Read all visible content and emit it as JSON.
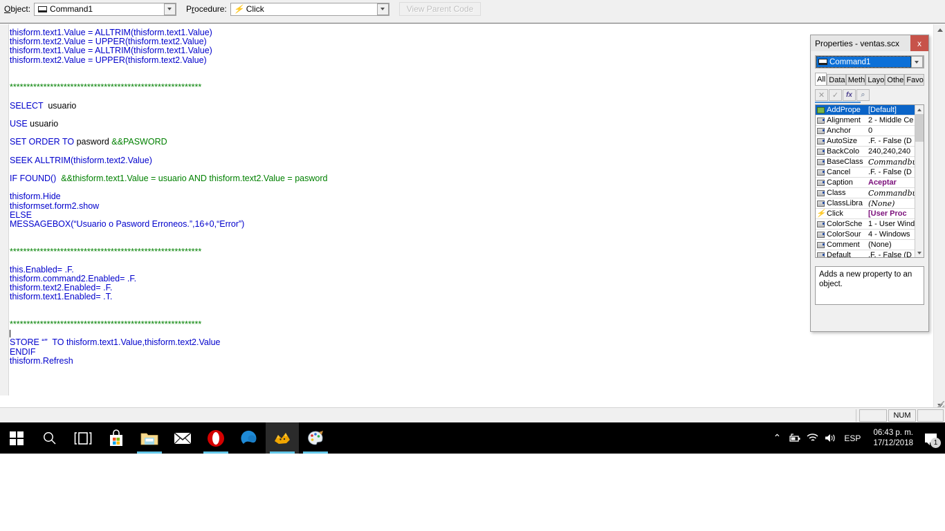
{
  "toolbar": {
    "object_label": "Object:",
    "object_value": "Command1",
    "procedure_label": "Procedure:",
    "procedure_value": "Click",
    "view_parent_code_label": "View Parent Code"
  },
  "editor": {
    "lines": [
      [
        {
          "t": "thisform.text1.Value = ALLTRIM(thisform.text1.Value)",
          "c": "kw"
        }
      ],
      [
        {
          "t": "thisform.text2.Value = UPPER(thisform.text2.Value)",
          "c": "kw"
        }
      ],
      [
        {
          "t": "thisform.text1.Value = ALLTRIM(thisform.text1.Value)",
          "c": "kw"
        }
      ],
      [
        {
          "t": "thisform.text2.Value = UPPER(thisform.text2.Value)",
          "c": "kw"
        }
      ],
      [],
      [],
      [
        {
          "t": "*********************************************************",
          "c": "cmt"
        }
      ],
      [],
      [
        {
          "t": "SELECT",
          "c": "kw"
        },
        {
          "t": "  usuario",
          "c": "plain"
        }
      ],
      [],
      [
        {
          "t": "USE",
          "c": "kw"
        },
        {
          "t": " usuario",
          "c": "plain"
        }
      ],
      [],
      [
        {
          "t": "SET ORDER TO",
          "c": "kw"
        },
        {
          "t": " pasword ",
          "c": "plain"
        },
        {
          "t": "&&PASWORD",
          "c": "cmt"
        }
      ],
      [],
      [
        {
          "t": "SEEK ALLTRIM(",
          "c": "kw"
        },
        {
          "t": "thisform.text2.Value)",
          "c": "kw"
        }
      ],
      [],
      [
        {
          "t": "IF FOUND()",
          "c": "kw"
        },
        {
          "t": "  &&thisform.text1.Value = usuario AND thisform.text2.Value = pasword",
          "c": "cmt"
        }
      ],
      [],
      [
        {
          "t": "thisform.Hide",
          "c": "kw"
        }
      ],
      [
        {
          "t": "thisformset.form2.show",
          "c": "kw"
        }
      ],
      [
        {
          "t": "ELSE",
          "c": "kw"
        }
      ],
      [
        {
          "t": "MESSAGEBOX(“Usuario o Pasword Erroneos.”,16+0,“Error”)",
          "c": "kw"
        }
      ],
      [],
      [],
      [
        {
          "t": "*********************************************************",
          "c": "cmt"
        }
      ],
      [],
      [
        {
          "t": "this.Enabled= .F.",
          "c": "kw"
        }
      ],
      [
        {
          "t": "thisform.command2.Enabled= .F.",
          "c": "kw"
        }
      ],
      [
        {
          "t": "thisform.text2.Enabled= .F.",
          "c": "kw"
        }
      ],
      [
        {
          "t": "thisform.text1.Enabled= .T.",
          "c": "kw"
        }
      ],
      [],
      [],
      [
        {
          "t": "*********************************************************",
          "c": "cmt"
        }
      ],
      [
        {
          "t": "",
          "c": "cursor"
        }
      ],
      [
        {
          "t": "STORE “”  TO thisform.text1.Value,thisform.text2.Value",
          "c": "kw"
        }
      ],
      [
        {
          "t": "ENDIF",
          "c": "kw"
        }
      ],
      [
        {
          "t": "thisform.Refresh",
          "c": "kw"
        }
      ]
    ]
  },
  "statusbar": {
    "panel1": "",
    "panel_num": "NUM",
    "panel3": ""
  },
  "properties": {
    "title": "Properties - ventas.scx",
    "close_label": "x",
    "object_value": "Command1",
    "tabs": [
      {
        "label": "All",
        "active": true
      },
      {
        "label": "Data",
        "active": false
      },
      {
        "label": "Meth",
        "active": false
      },
      {
        "label": "Layo",
        "active": false
      },
      {
        "label": "Othe",
        "active": false
      },
      {
        "label": "Favo",
        "active": false
      }
    ],
    "toolbar_buttons": [
      {
        "name": "cancel-edit-button",
        "glyph": "✕"
      },
      {
        "name": "accept-edit-button",
        "glyph": "✓"
      },
      {
        "name": "function-button",
        "glyph": "fx"
      },
      {
        "name": "zoom-button",
        "glyph": "⌕"
      }
    ],
    "rows": [
      {
        "icon": "add-property-icon",
        "name": "AddPrope",
        "value": "[Default]",
        "selected": true,
        "style": "normal"
      },
      {
        "icon": "property-icon",
        "name": "Alignment",
        "value": "2 - Middle Ce",
        "selected": false,
        "style": "normal"
      },
      {
        "icon": "property-icon",
        "name": "Anchor",
        "value": "0",
        "selected": false,
        "style": "normal"
      },
      {
        "icon": "property-icon",
        "name": "AutoSize",
        "value": ".F. - False (D",
        "selected": false,
        "style": "normal"
      },
      {
        "icon": "property-icon",
        "name": "BackColo",
        "value": "240,240,240",
        "selected": false,
        "style": "normal"
      },
      {
        "icon": "property-icon",
        "name": "BaseClass",
        "value": "Commandbu",
        "selected": false,
        "style": "script"
      },
      {
        "icon": "property-icon",
        "name": "Cancel",
        "value": ".F. - False (D",
        "selected": false,
        "style": "normal"
      },
      {
        "icon": "property-icon",
        "name": "Caption",
        "value": "Aceptar",
        "selected": false,
        "style": "purple"
      },
      {
        "icon": "property-icon",
        "name": "Class",
        "value": "Commandbu",
        "selected": false,
        "style": "script"
      },
      {
        "icon": "property-icon",
        "name": "ClassLibra",
        "value": "(None)",
        "selected": false,
        "style": "script"
      },
      {
        "icon": "event-icon",
        "name": "Click",
        "value": "[User Proc",
        "selected": false,
        "style": "purple"
      },
      {
        "icon": "property-icon",
        "name": "ColorSche",
        "value": "1 - User Wind",
        "selected": false,
        "style": "normal"
      },
      {
        "icon": "property-icon",
        "name": "ColorSour",
        "value": "4 - Windows",
        "selected": false,
        "style": "normal"
      },
      {
        "icon": "property-icon",
        "name": "Comment",
        "value": "(None)",
        "selected": false,
        "style": "normal"
      },
      {
        "icon": "property-icon",
        "name": "Default",
        "value": ".F. - False (D",
        "selected": false,
        "style": "normal"
      }
    ],
    "description": "Adds a new property to an object."
  },
  "taskbar": {
    "items": [
      {
        "name": "start-button",
        "icon": "windows-logo-icon",
        "active": false,
        "underline": false
      },
      {
        "name": "search-button",
        "icon": "search-icon",
        "active": false,
        "underline": false
      },
      {
        "name": "task-view-button",
        "icon": "task-view-icon",
        "active": false,
        "underline": false
      },
      {
        "name": "microsoft-store-button",
        "icon": "store-icon",
        "active": false,
        "underline": false
      },
      {
        "name": "file-explorer-button",
        "icon": "folder-icon",
        "active": false,
        "underline": true
      },
      {
        "name": "mail-button",
        "icon": "mail-icon",
        "active": false,
        "underline": false
      },
      {
        "name": "opera-button",
        "icon": "opera-icon",
        "active": false,
        "underline": true
      },
      {
        "name": "edge-button",
        "icon": "edge-icon",
        "active": false,
        "underline": false
      },
      {
        "name": "foxpro-button",
        "icon": "foxpro-icon",
        "active": true,
        "underline": true
      },
      {
        "name": "paint-button",
        "icon": "paint-icon",
        "active": false,
        "underline": true
      }
    ],
    "tray": {
      "chevron": "⌃",
      "battery": "battery-icon",
      "network": "wifi-icon",
      "volume": "volume-icon",
      "language": "ESP",
      "time": "06:43 p. m.",
      "date": "17/12/2018",
      "notification_count": "1"
    }
  },
  "colors": {
    "keyword_blue": "#0000cc",
    "comment_green": "#008000",
    "plain_black": "#000000",
    "selection_blue": "#0a64c8",
    "property_purple": "#7b0f7b",
    "close_red": "#c7534a",
    "taskbar_black": "#000000",
    "accent_underline": "#63c7e8"
  }
}
